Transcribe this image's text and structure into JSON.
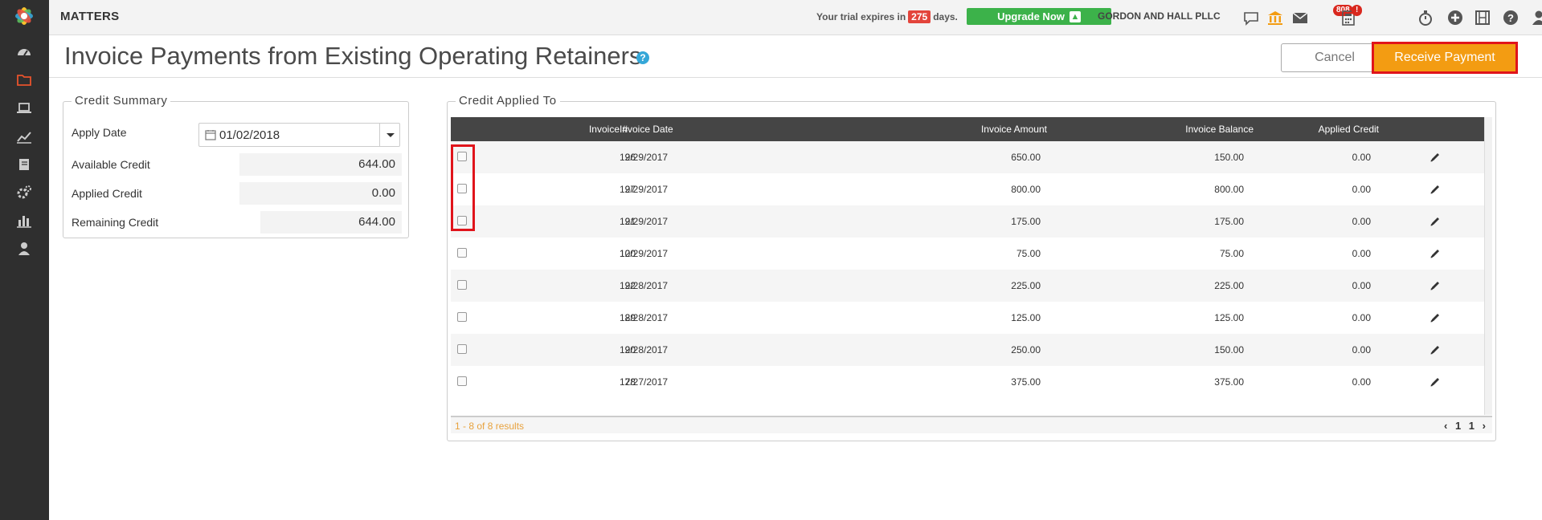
{
  "topbar": {
    "app_title": "MATTERS",
    "trial_prefix": "Your trial expires in",
    "trial_days": "275",
    "trial_suffix": "days.",
    "upgrade_label": "Upgrade Now",
    "firm_name": "GORDON AND HALL PLLC",
    "mail_badge": "808",
    "calc_badge": "!"
  },
  "page": {
    "title": "Invoice Payments from Existing Operating Retainers",
    "help": "?",
    "cancel_label": "Cancel",
    "receive_label": "Receive Payment"
  },
  "credit_summary": {
    "legend": "Credit Summary",
    "apply_date_label": "Apply Date",
    "apply_date_value": "01/02/2018",
    "available_label": "Available Credit",
    "available_value": "644.00",
    "applied_label": "Applied Credit",
    "applied_value": "0.00",
    "remaining_label": "Remaining Credit",
    "remaining_value": "644.00"
  },
  "credit_applied": {
    "legend": "Credit Applied To",
    "columns": {
      "invoice_no": "Invoice #",
      "invoice_date": "Invoice Date",
      "invoice_amount": "Invoice Amount",
      "invoice_balance": "Invoice Balance",
      "applied_credit": "Applied Credit"
    },
    "rows": [
      {
        "no": "96",
        "date": "12/29/2017",
        "amount": "650.00",
        "balance": "150.00",
        "applied": "0.00"
      },
      {
        "no": "97",
        "date": "12/29/2017",
        "amount": "800.00",
        "balance": "800.00",
        "applied": "0.00"
      },
      {
        "no": "91",
        "date": "12/29/2017",
        "amount": "175.00",
        "balance": "175.00",
        "applied": "0.00"
      },
      {
        "no": "100",
        "date": "12/29/2017",
        "amount": "75.00",
        "balance": "75.00",
        "applied": "0.00"
      },
      {
        "no": "92",
        "date": "12/28/2017",
        "amount": "225.00",
        "balance": "225.00",
        "applied": "0.00"
      },
      {
        "no": "89",
        "date": "12/28/2017",
        "amount": "125.00",
        "balance": "125.00",
        "applied": "0.00"
      },
      {
        "no": "90",
        "date": "12/28/2017",
        "amount": "250.00",
        "balance": "150.00",
        "applied": "0.00"
      },
      {
        "no": "78",
        "date": "12/27/2017",
        "amount": "375.00",
        "balance": "375.00",
        "applied": "0.00"
      }
    ],
    "results_text": "1 - 8 of 8 results",
    "pager": {
      "prev": "‹",
      "first": "1",
      "current": "1",
      "next": "›"
    }
  },
  "nav_icons": [
    "dashboard-icon",
    "matters-folder-icon",
    "laptop-icon",
    "chart-line-icon",
    "book-icon",
    "settings-gears-icon",
    "reports-bar-icon",
    "user-icon"
  ],
  "colors": {
    "accent": "#f39c12",
    "highlight": "#e0141b",
    "upgrade": "#3cb24a",
    "nav_bg": "#2f2f2f"
  }
}
